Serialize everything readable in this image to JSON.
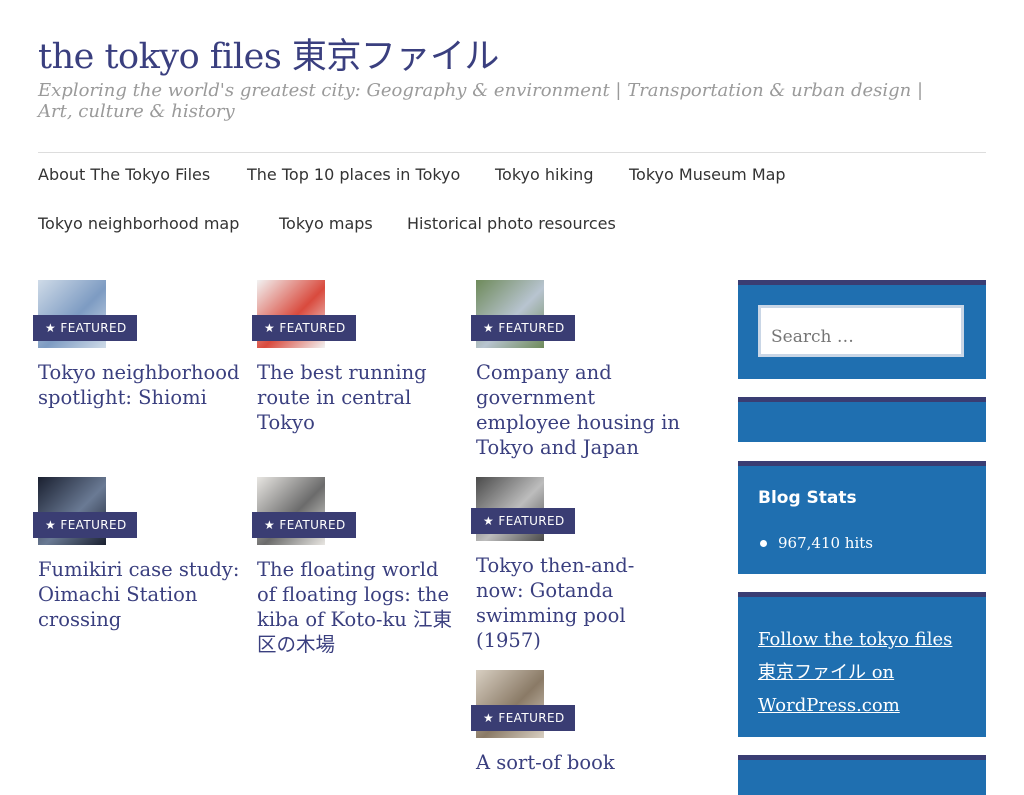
{
  "site": {
    "title": "the tokyo files 東京ファイル",
    "description": "Exploring the world's greatest city: Geography & environment | Transportation & urban design | Art, culture & history"
  },
  "nav": {
    "items": [
      "About The Tokyo Files",
      "The Top 10 places in Tokyo",
      "Tokyo hiking",
      "Tokyo Museum Map",
      "Tokyo neighborhood map",
      "Tokyo maps",
      "Historical photo resources"
    ]
  },
  "badge_label": "FEATURED",
  "badge_icon": "star-icon",
  "posts": [
    {
      "title": "Tokyo neighborhood spotlight: Shiomi",
      "thumb_colors": [
        "#cfdbe8",
        "#7d9bc2"
      ]
    },
    {
      "title": "The best running route in central Tokyo",
      "thumb_colors": [
        "#f2f2f2",
        "#d94a3d"
      ]
    },
    {
      "title": "Company and government employee housing in Tokyo and Japan",
      "thumb_colors": [
        "#6e8a5a",
        "#b8c4d0"
      ]
    },
    {
      "title": "Fumikiri case study: Oimachi Station crossing",
      "thumb_colors": [
        "#1a2030",
        "#6a7a94"
      ]
    },
    {
      "title": "The floating world of floating logs: the kiba of Koto-ku 江東区の木場",
      "thumb_colors": [
        "#e8e6e2",
        "#6b6b6b"
      ]
    },
    {
      "title": "Tokyo then-and-now: Gotanda swimming pool (1957)",
      "thumb_colors": [
        "#4a4a4a",
        "#bdbdbd"
      ]
    },
    {
      "title": "A sort-of book",
      "thumb_colors": [
        "#d8cfc2",
        "#8a7a66"
      ]
    }
  ],
  "sidebar": {
    "search_placeholder": "Search …",
    "stats_title": "Blog Stats",
    "stats_value": "967,410 hits",
    "follow_text": "Follow the tokyo files 東京ファイル on WordPress.com"
  },
  "colors": {
    "title": "#3a3f7f",
    "badge": "#3a3d73",
    "widget_bg": "#1f6fb0"
  }
}
